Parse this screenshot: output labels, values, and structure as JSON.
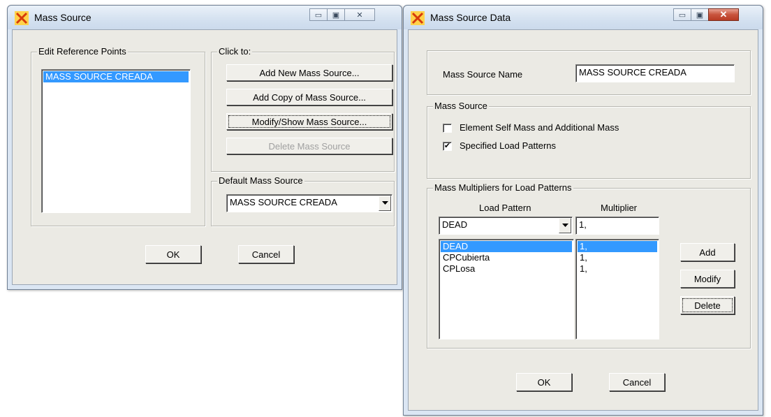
{
  "mass_source_window": {
    "title": "Mass Source",
    "edit_group_label": "Edit Reference Points",
    "list_items": [
      "MASS SOURCE CREADA"
    ],
    "click_group_label": "Click to:",
    "buttons": {
      "add_new": "Add New Mass Source...",
      "add_copy": "Add Copy of Mass Source...",
      "modify_show": "Modify/Show Mass Source...",
      "delete": "Delete Mass Source"
    },
    "default_group_label": "Default Mass Source",
    "default_value": "MASS SOURCE CREADA",
    "ok": "OK",
    "cancel": "Cancel"
  },
  "mass_source_data_window": {
    "title": "Mass Source Data",
    "name_label": "Mass Source Name",
    "name_value": "MASS SOURCE CREADA",
    "source_group_label": "Mass Source",
    "checkbox_element": {
      "label": "Element Self Mass and Additional Mass",
      "checked": false
    },
    "checkbox_specified": {
      "label": "Specified Load Patterns",
      "checked": true
    },
    "multipliers_group_label": "Mass Multipliers for Load Patterns",
    "col_load_pattern": "Load Pattern",
    "col_multiplier": "Multiplier",
    "combo_value": "DEAD",
    "multiplier_value": "1,",
    "patterns": [
      "DEAD",
      "CPCubierta",
      "CPLosa"
    ],
    "multipliers": [
      "1,",
      "1,",
      "1,"
    ],
    "add": "Add",
    "modify": "Modify",
    "delete": "Delete",
    "ok": "OK",
    "cancel": "Cancel"
  },
  "icons": {
    "app": "sap-app-icon",
    "minimize": "minimize-icon",
    "maximize": "maximize-icon",
    "close": "close-icon"
  },
  "colors": {
    "selection": "#3399ff",
    "close_red": "#c8533c"
  }
}
